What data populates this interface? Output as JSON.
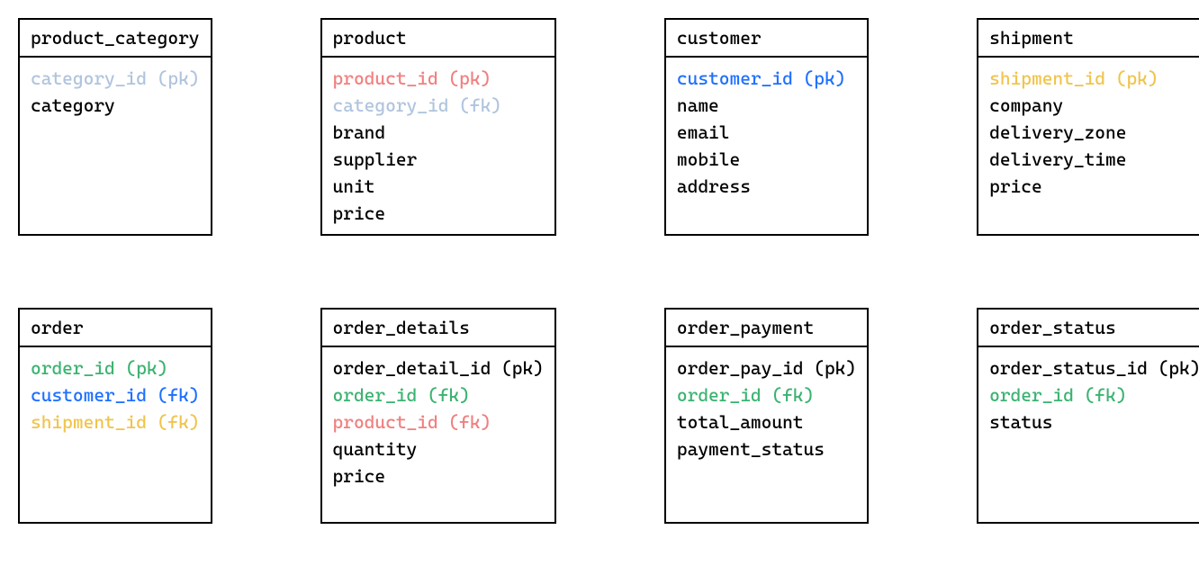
{
  "colors": {
    "lightblue": "#b0c4de",
    "pink": "#f08080",
    "blue": "#1e70ff",
    "gold": "#f0c44d",
    "green": "#3cb371",
    "black": "#000000"
  },
  "entities": [
    {
      "name": "product_category",
      "fields": [
        {
          "text": "category_id (pk)",
          "color": "lightblue"
        },
        {
          "text": "category",
          "color": "black"
        }
      ]
    },
    {
      "name": "product",
      "fields": [
        {
          "text": "product_id (pk)",
          "color": "pink"
        },
        {
          "text": "category_id (fk)",
          "color": "lightblue"
        },
        {
          "text": "brand",
          "color": "black"
        },
        {
          "text": "supplier",
          "color": "black"
        },
        {
          "text": "unit",
          "color": "black"
        },
        {
          "text": "price",
          "color": "black"
        }
      ]
    },
    {
      "name": "customer",
      "fields": [
        {
          "text": "customer_id (pk)",
          "color": "blue"
        },
        {
          "text": "name",
          "color": "black"
        },
        {
          "text": "email",
          "color": "black"
        },
        {
          "text": "mobile",
          "color": "black"
        },
        {
          "text": "address",
          "color": "black"
        }
      ]
    },
    {
      "name": "shipment",
      "fields": [
        {
          "text": "shipment_id (pk)",
          "color": "gold"
        },
        {
          "text": "company",
          "color": "black"
        },
        {
          "text": "delivery_zone",
          "color": "black"
        },
        {
          "text": "delivery_time",
          "color": "black"
        },
        {
          "text": "price",
          "color": "black"
        }
      ]
    },
    {
      "name": "order",
      "fields": [
        {
          "text": "order_id (pk)",
          "color": "green"
        },
        {
          "text": "customer_id (fk)",
          "color": "blue"
        },
        {
          "text": "shipment_id (fk)",
          "color": "gold"
        }
      ]
    },
    {
      "name": "order_details",
      "fields": [
        {
          "text": "order_detail_id (pk)",
          "color": "black"
        },
        {
          "text": "order_id (fk)",
          "color": "green"
        },
        {
          "text": "product_id (fk)",
          "color": "pink"
        },
        {
          "text": "quantity",
          "color": "black"
        },
        {
          "text": "price",
          "color": "black"
        }
      ]
    },
    {
      "name": "order_payment",
      "fields": [
        {
          "text": "order_pay_id (pk)",
          "color": "black"
        },
        {
          "text": "order_id (fk)",
          "color": "green"
        },
        {
          "text": "total_amount",
          "color": "black"
        },
        {
          "text": "payment_status",
          "color": "black"
        }
      ]
    },
    {
      "name": "order_status",
      "fields": [
        {
          "text": "order_status_id (pk)",
          "color": "black"
        },
        {
          "text": "order_id (fk)",
          "color": "green"
        },
        {
          "text": "status",
          "color": "black"
        }
      ]
    }
  ]
}
